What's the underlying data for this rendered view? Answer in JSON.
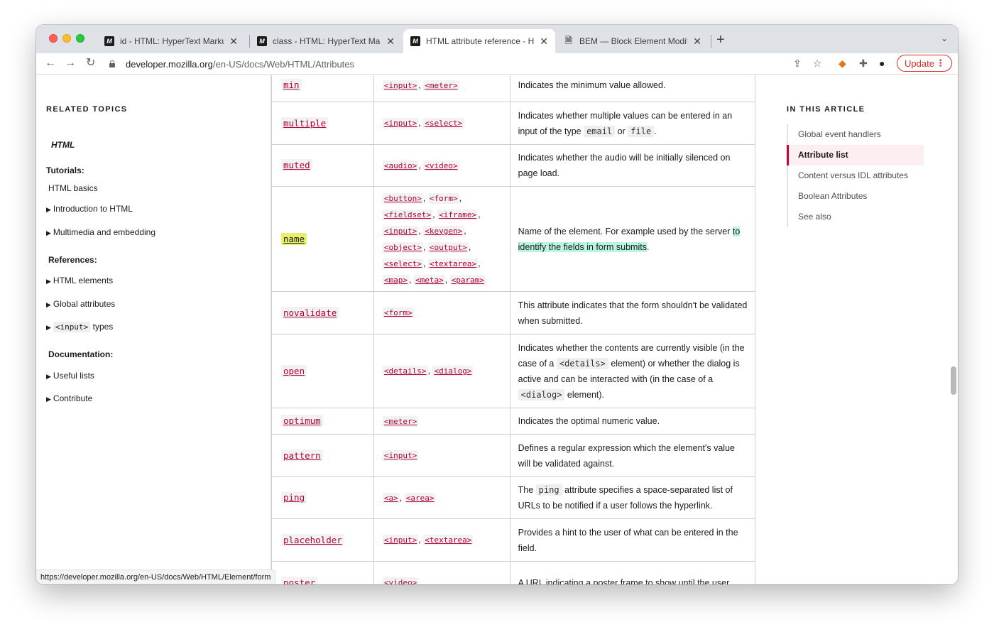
{
  "browser": {
    "tabs": [
      {
        "title": "id - HTML: HyperText Markup L",
        "favicon": "M"
      },
      {
        "title": "class - HTML: HyperText Marku",
        "favicon": "M"
      },
      {
        "title": "HTML attribute reference - HTM",
        "favicon": "M"
      },
      {
        "title": "BEM — Block Element Modifier",
        "favicon": "doc"
      }
    ],
    "tab_close": "✕",
    "new_tab": "+",
    "tab_menu": "⌄",
    "url_host": "developer.mozilla.org",
    "url_path": "/en-US/docs/Web/HTML/Attributes",
    "update_label": "Update",
    "status_url": "https://developer.mozilla.org/en-US/docs/Web/HTML/Element/form"
  },
  "sidebar": {
    "heading": "RELATED TOPICS",
    "html_label": "HTML",
    "tutorials_label": "Tutorials:",
    "html_basics": "HTML basics",
    "intro_html": "Introduction to HTML",
    "multimedia": "Multimedia and embedding",
    "references_label": "References:",
    "html_elements": "HTML elements",
    "global_attributes": "Global attributes",
    "input_code": "<input>",
    "input_types": " types",
    "documentation_label": "Documentation:",
    "useful_lists": "Useful lists",
    "contribute": "Contribute"
  },
  "table": {
    "sep": ", ",
    "rows": [
      {
        "attr": "min",
        "elements": [
          "<input>",
          "<meter>"
        ],
        "desc": "Indicates the minimum value allowed."
      },
      {
        "attr": "multiple",
        "elements": [
          "<input>",
          "<select>"
        ],
        "desc_a": "Indicates whether multiple values can be entered in an input of the type ",
        "code1": "email",
        "desc_b": " or ",
        "code2": "file",
        "desc_c": "."
      },
      {
        "attr": "muted",
        "elements": [
          "<audio>",
          "<video>"
        ],
        "desc": "Indicates whether the audio will be initially silenced on page load."
      },
      {
        "attr": "name",
        "elements": [
          "<button>",
          "<form>",
          "<fieldset>",
          "<iframe>",
          "<input>",
          "<keygen>",
          "<object>",
          "<output>",
          "<select>",
          "<textarea>",
          "<map>",
          "<meta>",
          "<param>"
        ],
        "desc_a": "Name of the element. For example used by the server ",
        "desc_mark": "to identify the fields in form submits",
        "desc_c": "."
      },
      {
        "attr": "novalidate",
        "elements": [
          "<form>"
        ],
        "desc": "This attribute indicates that the form shouldn't be validated when submitted."
      },
      {
        "attr": "open",
        "elements": [
          "<details>",
          "<dialog>"
        ],
        "desc_a": "Indicates whether the contents are currently visible (in the case of a ",
        "code1": "<details>",
        "desc_b": " element) or whether the dialog is active and can be interacted with (in the case of a ",
        "code2": "<dialog>",
        "desc_c": " element)."
      },
      {
        "attr": "optimum",
        "elements": [
          "<meter>"
        ],
        "desc": "Indicates the optimal numeric value."
      },
      {
        "attr": "pattern",
        "elements": [
          "<input>"
        ],
        "desc": "Defines a regular expression which the element's value will be validated against."
      },
      {
        "attr": "ping",
        "elements": [
          "<a>",
          "<area>"
        ],
        "desc_a": "The ",
        "code1": "ping",
        "desc_b": " attribute specifies a space-separated list of URLs to be notified if a user follows the hyperlink."
      },
      {
        "attr": "placeholder",
        "elements": [
          "<input>",
          "<textarea>"
        ],
        "desc": "Provides a hint to the user of what can be entered in the field."
      },
      {
        "attr": "poster",
        "elements": [
          "<video>"
        ],
        "desc": "A URL indicating a poster frame to show until the user"
      }
    ]
  },
  "toc": {
    "heading": "IN THIS ARTICLE",
    "items": [
      "Global event handlers",
      "Attribute list",
      "Content versus IDL attributes",
      "Boolean Attributes",
      "See also"
    ]
  },
  "colors": {
    "accent": "#b3003c",
    "highlight_yellow": "#e8f06a",
    "highlight_green": "#b8f5e3",
    "update_red": "#d93025"
  }
}
